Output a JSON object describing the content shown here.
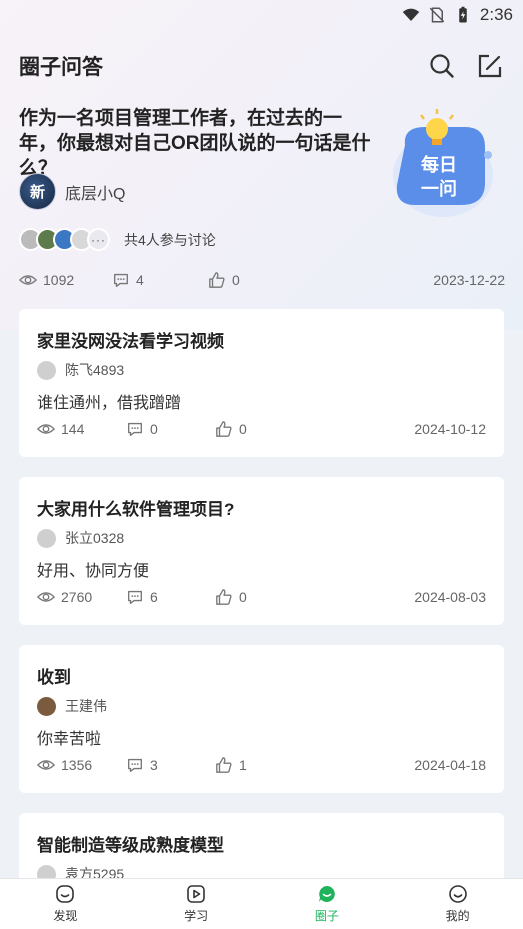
{
  "status_bar": {
    "time": "2:36"
  },
  "header": {
    "title": "圈子问答"
  },
  "topic": {
    "question": "作为一名项目管理工作者，在过去的一年，你最想对自己OR团队说的一句话是什么？",
    "badge_line1": "每日",
    "badge_line2": "一问",
    "author_avatar_text": "新",
    "author": "底层小Q",
    "participants_label": "共4人参与讨论",
    "more_label": "···",
    "views": "1092",
    "comments": "4",
    "likes": "0",
    "date": "2023-12-22"
  },
  "posts": [
    {
      "title": "家里没网没法看学习视频",
      "author": "陈飞4893",
      "body": "谁住通州，借我蹭蹭",
      "views": "144",
      "comments": "0",
      "likes": "0",
      "date": "2024-10-12"
    },
    {
      "title": "大家用什么软件管理项目?",
      "author": "张立0328",
      "body": "好用、协同方便",
      "views": "2760",
      "comments": "6",
      "likes": "0",
      "date": "2024-08-03"
    },
    {
      "title": "收到",
      "author": "王建伟",
      "body": "你幸苦啦",
      "views": "1356",
      "comments": "3",
      "likes": "1",
      "date": "2024-04-18"
    },
    {
      "title": "智能制造等级成熟度模型",
      "author": "袁方5295"
    }
  ],
  "nav": [
    {
      "label": "发现"
    },
    {
      "label": "学习"
    },
    {
      "label": "圈子"
    },
    {
      "label": "我的"
    }
  ],
  "colors": {
    "accent": "#1fb35c",
    "badge_blue": "#5a8ee8"
  }
}
